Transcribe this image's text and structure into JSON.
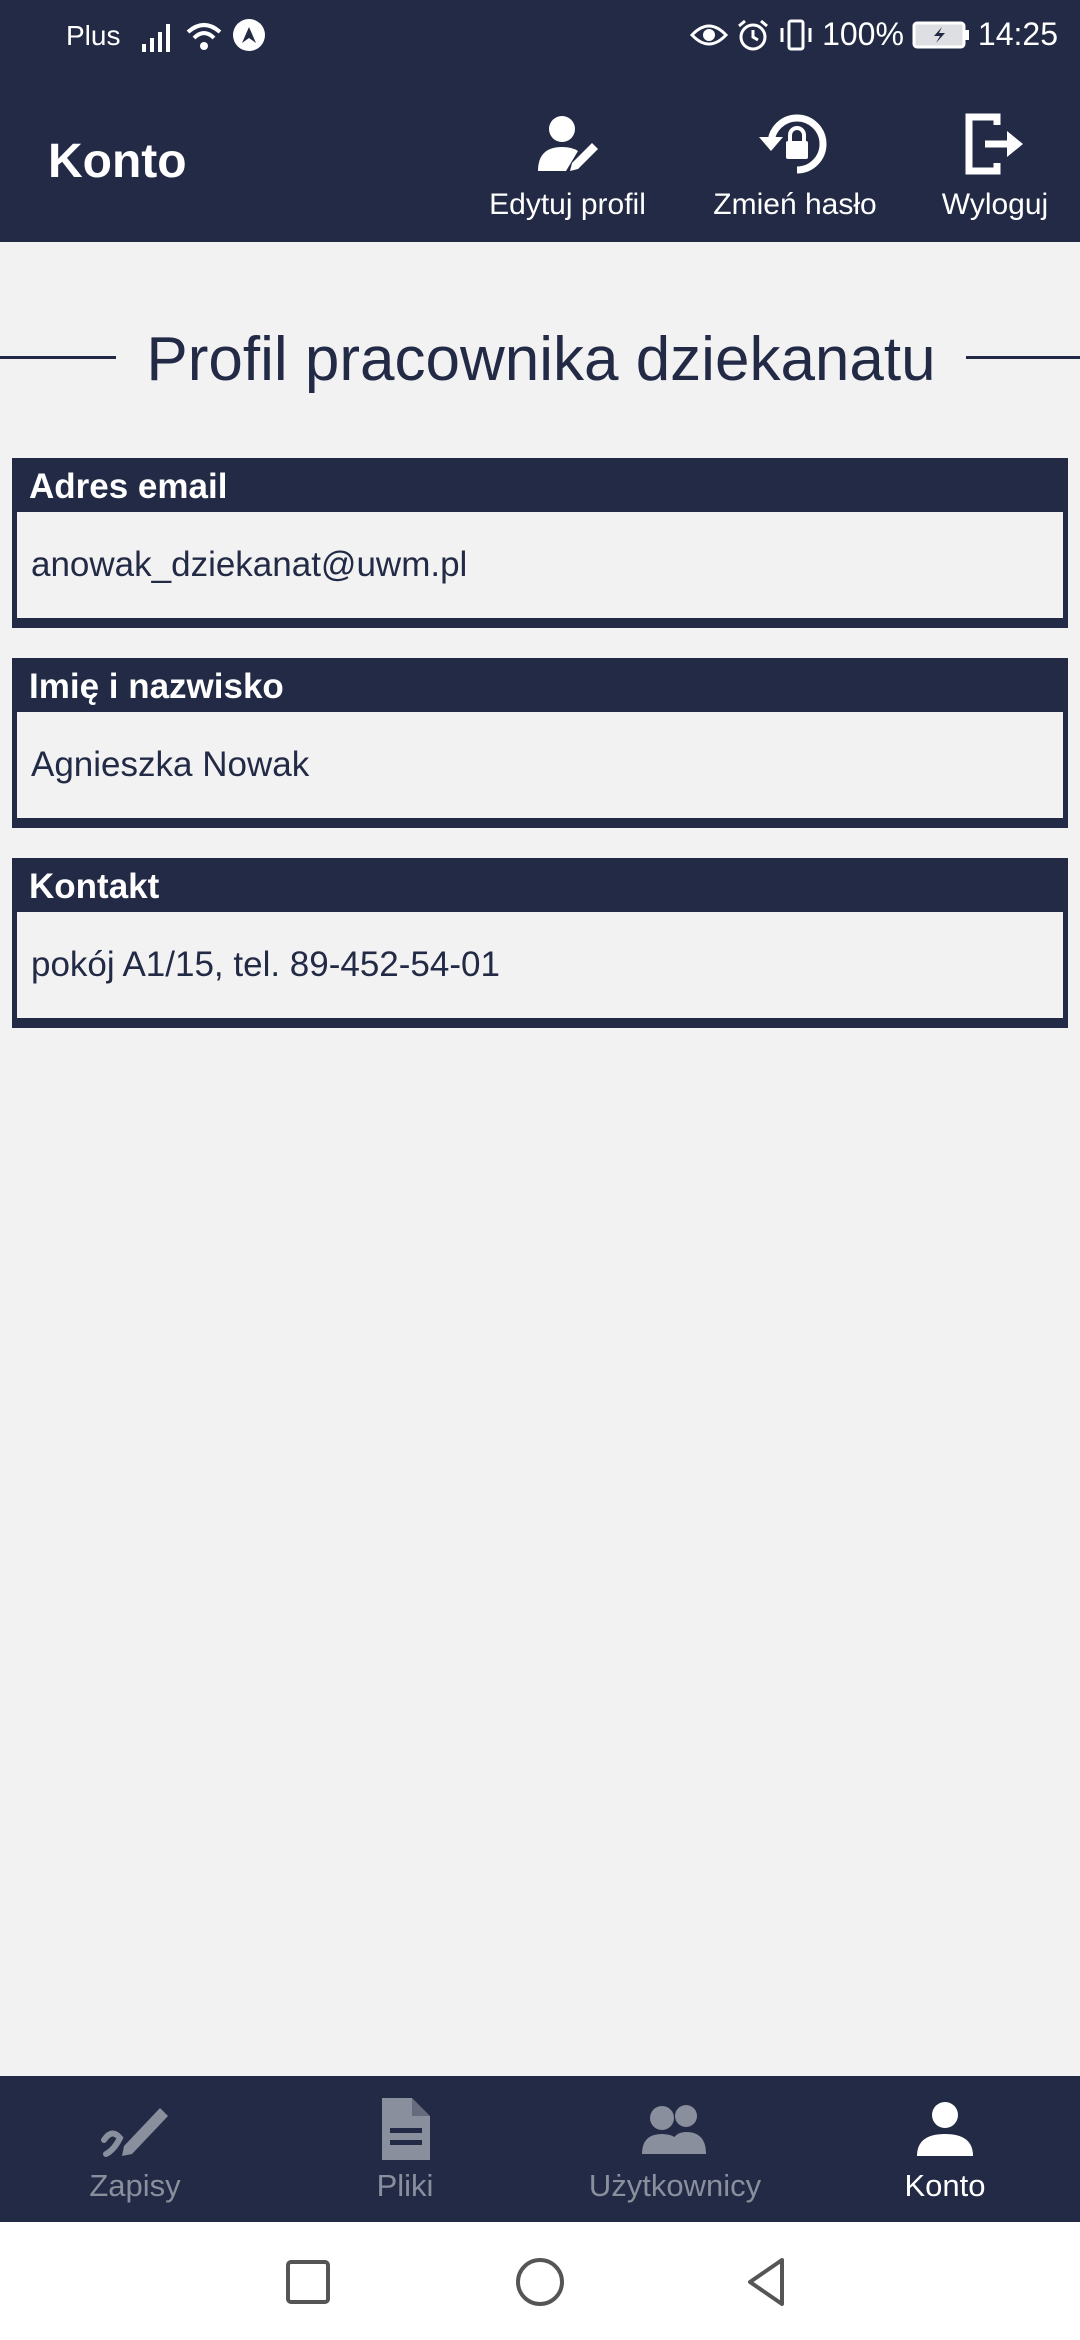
{
  "status_bar": {
    "carrier": "Plus",
    "battery": "100%",
    "time": "14:25"
  },
  "app_bar": {
    "title": "Konto",
    "actions": [
      {
        "label": "Edytuj profil",
        "icon": "edit-profile-icon"
      },
      {
        "label": "Zmień hasło",
        "icon": "change-password-icon"
      },
      {
        "label": "Wyloguj",
        "icon": "logout-icon"
      }
    ]
  },
  "main": {
    "heading": "Profil pracownika dziekanatu",
    "fields": [
      {
        "label": "Adres email",
        "value": "anowak_dziekanat@uwm.pl"
      },
      {
        "label": "Imię i nazwisko",
        "value": "Agnieszka Nowak"
      },
      {
        "label": "Kontakt",
        "value": "pokój A1/15, tel. 89-452-54-01"
      }
    ]
  },
  "bottom_nav": {
    "items": [
      {
        "label": "Zapisy",
        "icon": "signature-icon",
        "active": false
      },
      {
        "label": "Pliki",
        "icon": "file-icon",
        "active": false
      },
      {
        "label": "Użytkownicy",
        "icon": "users-icon",
        "active": false
      },
      {
        "label": "Konto",
        "icon": "account-icon",
        "active": true
      }
    ]
  },
  "colors": {
    "primary": "#222a45",
    "background": "#f2f2f3",
    "inactive": "#8a8f9d",
    "active": "#ffffff"
  }
}
